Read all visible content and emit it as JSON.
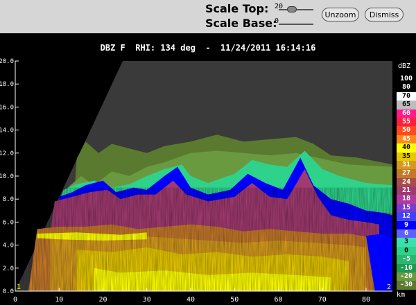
{
  "controls": {
    "scale_top_label": "Scale Top:",
    "scale_top_value": "20",
    "scale_top_fraction": 0.35,
    "scale_base_label": "Scale Base:",
    "scale_base_value": "0",
    "unzoom_label": "Unzoom",
    "dismiss_label": "Dismiss"
  },
  "plot": {
    "title": "DBZ F  RHI: 134 deg  -  11/24/2011 16:14:16",
    "x_unit": "km",
    "cb_unit": "dBZ",
    "corner_left": "1",
    "corner_right": "2"
  },
  "colors": {
    "panel_bg": "#d6d6d6",
    "plot_bg": "#000000",
    "no_data": "#3a3a3a"
  },
  "chart_data": {
    "type": "heatmap",
    "title": "DBZ F  RHI: 134 deg  -  11/24/2011 16:14:16",
    "xlabel": "km",
    "ylabel": "",
    "x_ticks": [
      0,
      10,
      20,
      30,
      40,
      50,
      60,
      70,
      80
    ],
    "y_ticks": [
      "0.0",
      "2.0",
      "4.0",
      "6.0",
      "8.0",
      "10.0",
      "12.0",
      "14.0",
      "16.0",
      "18.0",
      "20.0"
    ],
    "xlim": [
      0,
      86
    ],
    "ylim": [
      0,
      20
    ],
    "colorbar": {
      "unit": "dBZ",
      "levels": [
        {
          "label": "100",
          "color": "#000000"
        },
        {
          "label": "80",
          "color": "#000000"
        },
        {
          "label": "70",
          "color": "#ffffff"
        },
        {
          "label": "65",
          "color": "#bdbdbd"
        },
        {
          "label": "60",
          "color": "#ff1a8c"
        },
        {
          "label": "55",
          "color": "#ff1e3c"
        },
        {
          "label": "50",
          "color": "#ff4a1e"
        },
        {
          "label": "45",
          "color": "#ff8a1a"
        },
        {
          "label": "40",
          "color": "#ffff00"
        },
        {
          "label": "35",
          "color": "#e6c800"
        },
        {
          "label": "31",
          "color": "#d49a1c"
        },
        {
          "label": "27",
          "color": "#c4782a"
        },
        {
          "label": "24",
          "color": "#a84e4a"
        },
        {
          "label": "21",
          "color": "#a03a70"
        },
        {
          "label": "18",
          "color": "#b03aa0"
        },
        {
          "label": "15",
          "color": "#7a3ad0"
        },
        {
          "label": "12",
          "color": "#4040ff"
        },
        {
          "label": "9",
          "color": "#0000ff"
        },
        {
          "label": "6",
          "color": "#6060ff"
        },
        {
          "label": "3",
          "color": "#3ce0b0"
        },
        {
          "label": "0",
          "color": "#2ed28a"
        },
        {
          "label": "-5",
          "color": "#28b870"
        },
        {
          "label": "-10",
          "color": "#1c9a50"
        },
        {
          "label": "-20",
          "color": "#6a9a40"
        },
        {
          "label": "-30",
          "color": "#5a7a30"
        }
      ]
    }
  }
}
